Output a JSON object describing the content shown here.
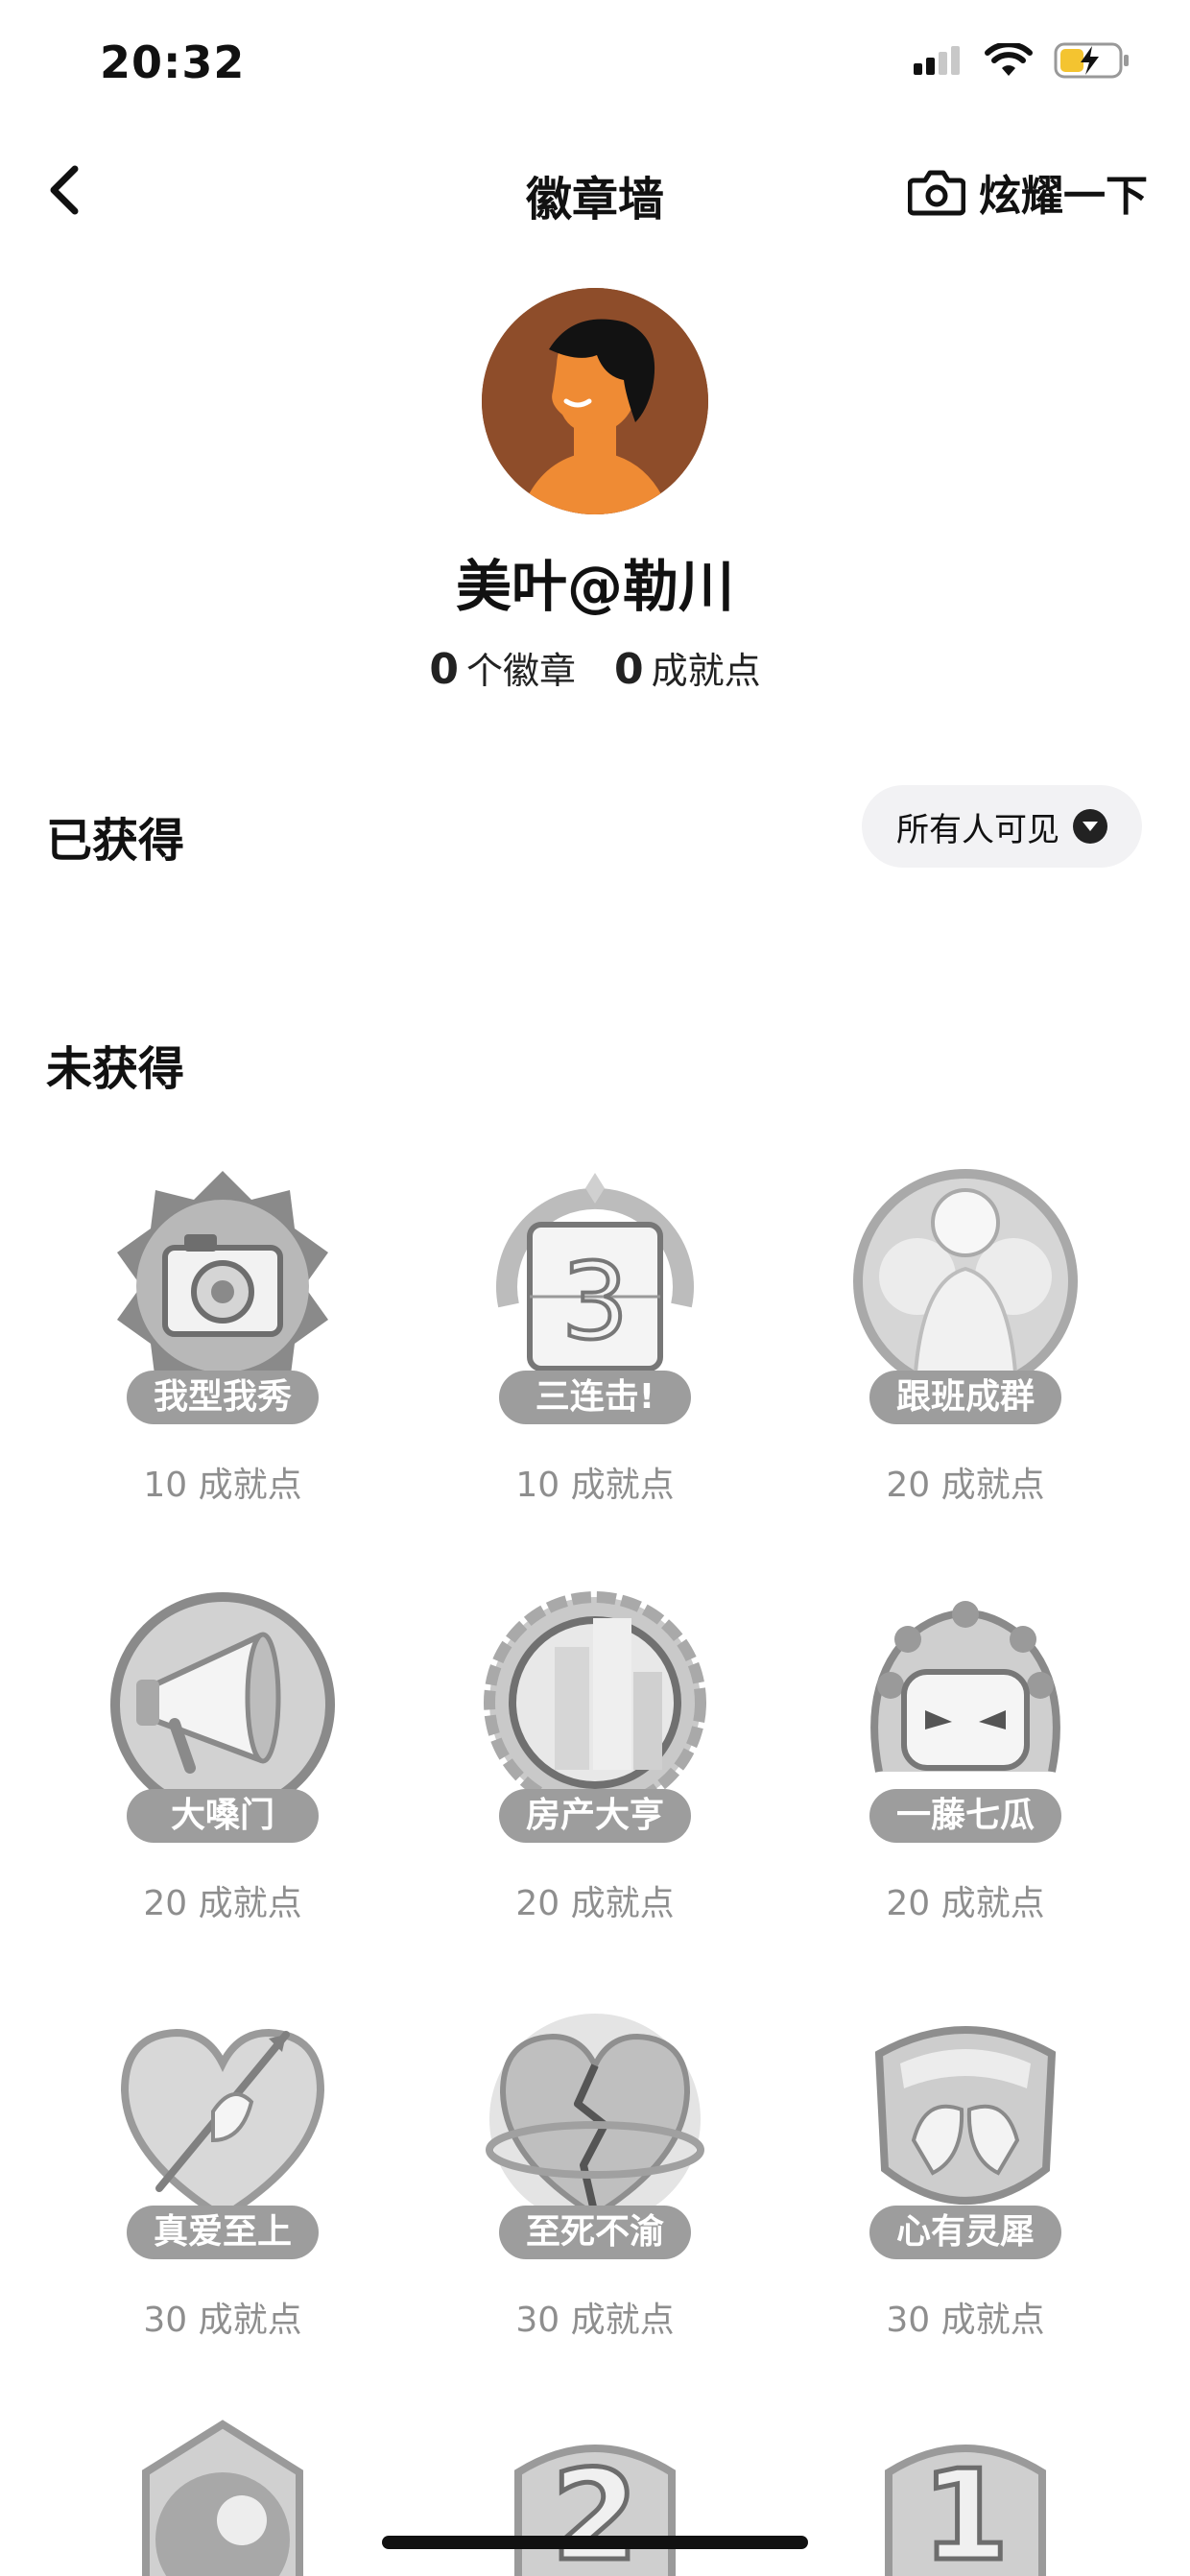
{
  "status_bar": {
    "time": "20:32"
  },
  "nav": {
    "title": "徽章墙",
    "share_label": "炫耀一下"
  },
  "profile": {
    "name": "美叶@勒川",
    "badge_count": "0",
    "badge_count_label": "个徽章",
    "points": "0",
    "points_label": "成就点"
  },
  "earned": {
    "title": "已获得",
    "visibility_label": "所有人可见"
  },
  "unearned": {
    "title": "未获得",
    "badges": [
      {
        "name": "我型我秀",
        "points": "10 成就点",
        "icon": "camera-badge"
      },
      {
        "name": "三连击!",
        "points": "10 成就点",
        "icon": "calendar-three-badge"
      },
      {
        "name": "跟班成群",
        "points": "20 成就点",
        "icon": "crowd-badge"
      },
      {
        "name": "大嗓门",
        "points": "20 成就点",
        "icon": "megaphone-badge"
      },
      {
        "name": "房产大亨",
        "points": "20 成就点",
        "icon": "building-badge"
      },
      {
        "name": "一藤七瓜",
        "points": "20 成就点",
        "icon": "gourd-badge"
      },
      {
        "name": "真爱至上",
        "points": "30 成就点",
        "icon": "cupid-heart-badge"
      },
      {
        "name": "至死不渝",
        "points": "30 成就点",
        "icon": "broken-heart-badge"
      },
      {
        "name": "心有灵犀",
        "points": "30 成就点",
        "icon": "birds-badge"
      },
      {
        "name": "",
        "points": "",
        "icon": "partial-badge"
      },
      {
        "name": "",
        "points": "",
        "icon": "number-two-badge"
      },
      {
        "name": "",
        "points": "",
        "icon": "number-one-badge"
      }
    ]
  }
}
